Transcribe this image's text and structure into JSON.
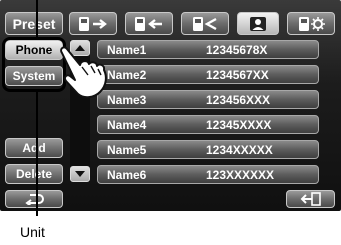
{
  "toolbar": {
    "preset_label": "Preset",
    "icons": [
      "phone-send-icon",
      "phone-receive-icon",
      "phone-edit-icon",
      "contacts-icon",
      "phone-settings-icon"
    ]
  },
  "left_column": {
    "phone_label": "Phone",
    "system_label": "System",
    "add_label": "Add",
    "delete_label": "Delete"
  },
  "list": [
    {
      "name": "Name1",
      "number": "12345678X"
    },
    {
      "name": "Name2",
      "number": "1234567XX"
    },
    {
      "name": "Name3",
      "number": "123456XXX"
    },
    {
      "name": "Name4",
      "number": "12345XXXX"
    },
    {
      "name": "Name5",
      "number": "1234XXXXX"
    },
    {
      "name": "Name6",
      "number": "123XXXXXX"
    }
  ],
  "callout": {
    "label": "Unit"
  },
  "colors": {
    "screen": "#1c1c1c",
    "button": "#6c6c6c",
    "selected": "#cfcfcf"
  }
}
